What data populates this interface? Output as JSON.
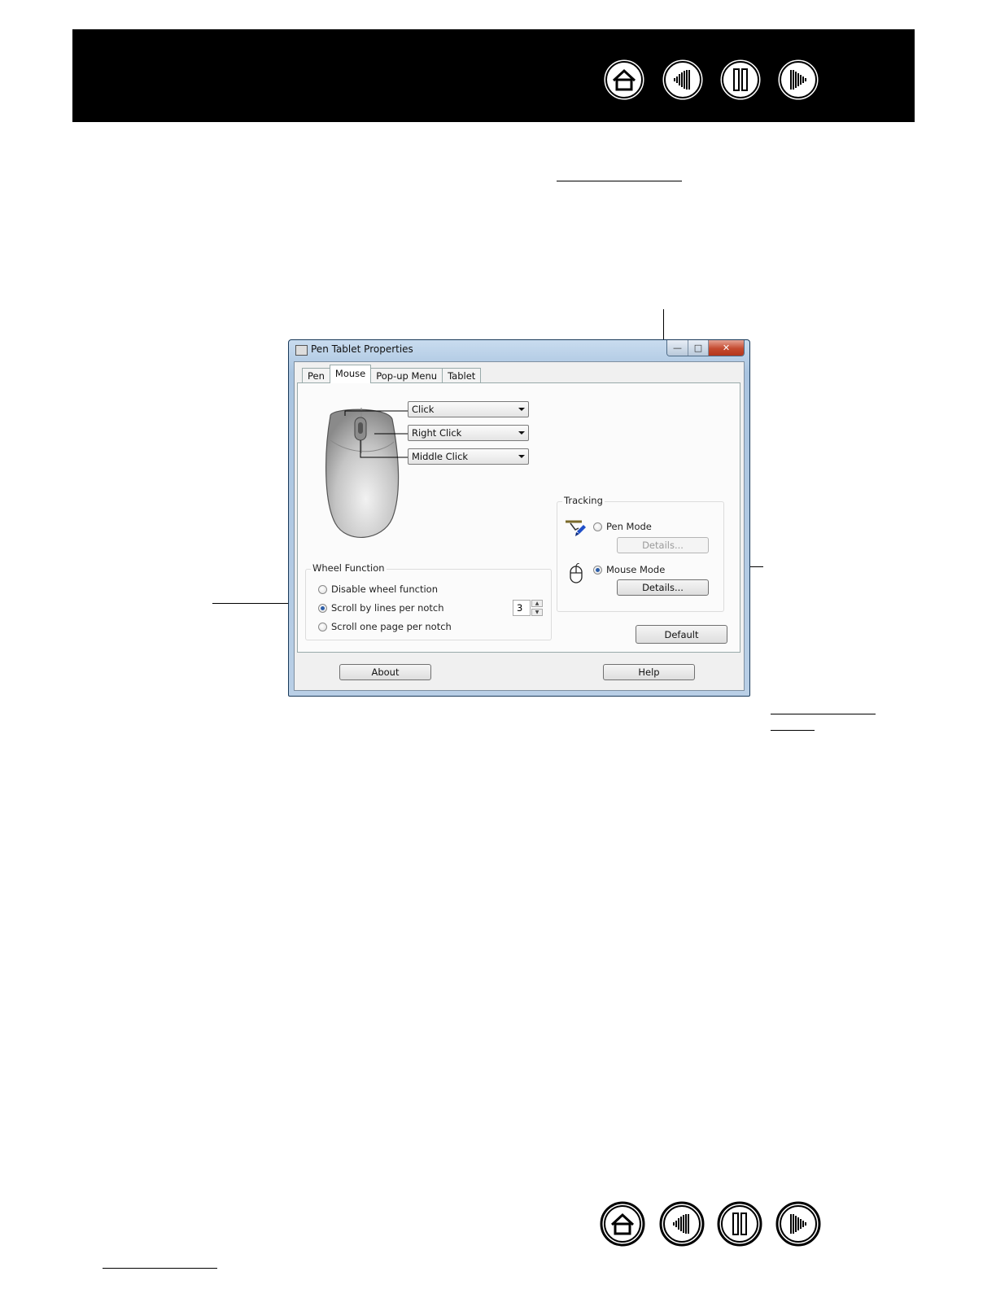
{
  "nav": {
    "buttons": [
      "home-icon",
      "contents-icon",
      "index-icon",
      "troubleshooting-icon"
    ]
  },
  "window": {
    "title": "Pen Tablet Properties",
    "controls": {
      "minimize": "—",
      "maximize": "□",
      "close": "✕"
    },
    "tabs": [
      {
        "label": "Pen",
        "active": false
      },
      {
        "label": "Mouse",
        "active": true
      },
      {
        "label": "Pop-up Menu",
        "active": false
      },
      {
        "label": "Tablet",
        "active": false
      }
    ],
    "buttons": {
      "left": "Click",
      "right": "Right Click",
      "middle": "Middle Click"
    },
    "wheel": {
      "group_title": "Wheel Function",
      "options": [
        "Disable wheel function",
        "Scroll by lines per notch",
        "Scroll one page per notch"
      ],
      "selected_index": 1,
      "lines_per_notch": "3"
    },
    "tracking": {
      "group_title": "Tracking",
      "pen_mode_label": "Pen Mode",
      "pen_details": "Details...",
      "mouse_mode_label": "Mouse Mode",
      "mouse_details": "Details...",
      "selected": "mouse"
    },
    "default_button": "Default",
    "about_button": "About",
    "help_button": "Help"
  }
}
